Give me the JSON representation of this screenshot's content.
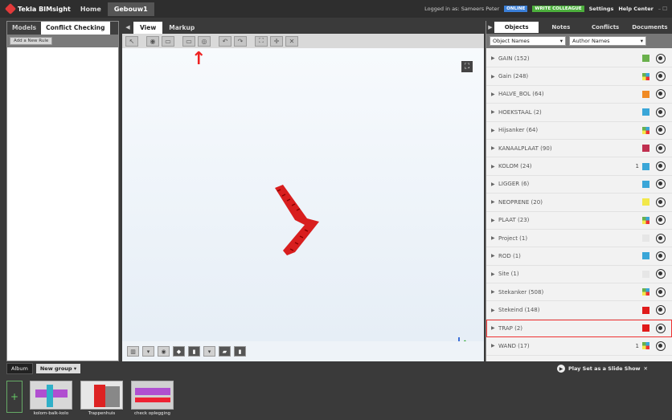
{
  "app": {
    "title": "Tekla BIMsight",
    "tabs": [
      "Home",
      "Gebouw1"
    ]
  },
  "topbar": {
    "logged_in": "Logged in as: Sameers Peter",
    "badge_online": "ONLINE",
    "badge_write": "WRITE COLLEAGUE",
    "settings": "Settings",
    "help": "Help Center",
    "window_controls": "– ☐"
  },
  "left_panel": {
    "tabs": [
      "Models",
      "Conflict Checking"
    ],
    "add_rule": "Add a New Rule"
  },
  "center": {
    "tabs": [
      "View",
      "Markup"
    ],
    "fullscreen_icon": "⛶",
    "colors": {
      "model": "#d81e1e",
      "annotation": "#e22222"
    }
  },
  "right_panel": {
    "tabs": [
      "Objects",
      "Notes",
      "Conflicts",
      "Documents"
    ],
    "select_left": "Object Names",
    "select_right": "Author Names",
    "objects": [
      {
        "name": "GAIN (152)",
        "color": "#6ab04c"
      },
      {
        "name": "Gain (248)",
        "color": "multi"
      },
      {
        "name": "HALVE_BOL (64)",
        "color": "#f08a24"
      },
      {
        "name": "HOEKSTAAL (2)",
        "color": "#3aa6d8"
      },
      {
        "name": "Hijsanker (64)",
        "color": "multi"
      },
      {
        "name": "KANAALPLAAT (90)",
        "color": "#c03050"
      },
      {
        "name": "KOLOM (24)",
        "color": "#3aa6d8",
        "docs": "1"
      },
      {
        "name": "LIGGER (6)",
        "color": "#3aa6d8"
      },
      {
        "name": "NEOPRENE (20)",
        "color": "#f2e84a"
      },
      {
        "name": "PLAAT (23)",
        "color": "multi"
      },
      {
        "name": "Project (1)",
        "color": "#e6e6e6"
      },
      {
        "name": "ROD (1)",
        "color": "#3aa6d8"
      },
      {
        "name": "Site (1)",
        "color": "#e6e6e6"
      },
      {
        "name": "Stekanker (508)",
        "color": "multi"
      },
      {
        "name": "Stekeind (148)",
        "color": "#e01b1b"
      },
      {
        "name": "TRAP (2)",
        "color": "#e01b1b",
        "selected": true
      },
      {
        "name": "WAND (17)",
        "color": "multi",
        "docs": "1"
      }
    ]
  },
  "bottom": {
    "album": "Album",
    "group": "New group",
    "slideshow": "Play Set as a Slide Show",
    "thumbnails": [
      "kolom-balk-kolo",
      "Trappenhuis",
      "check oplegging"
    ]
  }
}
